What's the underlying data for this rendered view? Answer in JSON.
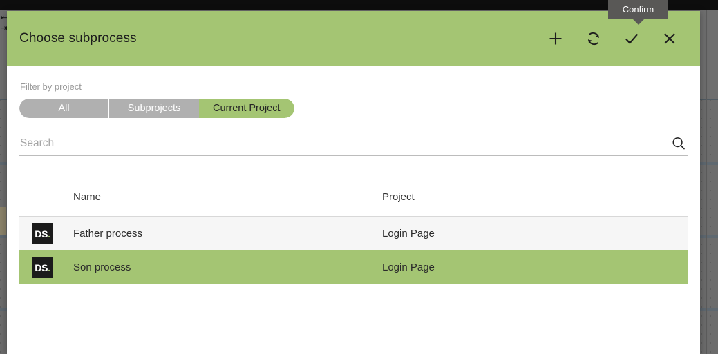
{
  "dialog": {
    "title": "Choose subprocess",
    "header_actions": [
      {
        "name": "add-subprocess-button",
        "icon": "plus-icon",
        "label": "Add"
      },
      {
        "name": "refresh-button",
        "icon": "refresh-icon",
        "label": "Refresh"
      },
      {
        "name": "confirm-button",
        "icon": "check-icon",
        "label": "Confirm"
      },
      {
        "name": "close-button",
        "icon": "close-icon",
        "label": "Close"
      }
    ]
  },
  "tooltip": {
    "text": "Confirm",
    "target": "confirm-button"
  },
  "filter": {
    "label": "Filter by project",
    "options": [
      {
        "label": "All",
        "active": false
      },
      {
        "label": "Subprojects",
        "active": false
      },
      {
        "label": "Current Project",
        "active": true
      }
    ],
    "selected": "Current Project"
  },
  "search": {
    "value": "",
    "placeholder": "Search",
    "icon": "search-icon"
  },
  "table": {
    "columns": [
      "",
      "Name",
      "Project"
    ],
    "rows": [
      {
        "badge": "DS",
        "badge_dot": ".",
        "name": "Father process",
        "project": "Login Page",
        "selected": false
      },
      {
        "badge": "DS",
        "badge_dot": ".",
        "name": "Son process",
        "project": "Login Page",
        "selected": true
      }
    ]
  },
  "colors": {
    "accent_green": "#a4c573",
    "segment_inactive": "#b0b0b0",
    "badge_bg": "#1b1b1b",
    "tooltip_bg": "#595856",
    "row_alt": "#f6f6f6"
  }
}
